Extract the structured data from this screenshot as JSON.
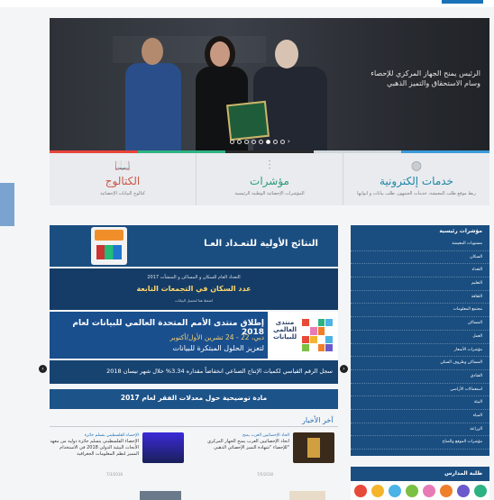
{
  "hero": {
    "caption": "الرئيس يمنح الجهاز المركزي للإحصاء وسام الاستحقاق والتميز الذهبي",
    "slides_total": 8,
    "slide_active": 5,
    "next_arrow": "›"
  },
  "strip_colors": [
    "#e8433a",
    "#2db383",
    "#2a2a2a",
    "#cfd6db",
    "#3a9ad9"
  ],
  "services": [
    {
      "title": "الكتالوج",
      "subtitle": "كتالوج البيانات الإحصائية",
      "icon": "book-icon",
      "glyph": "📖"
    },
    {
      "title": "مؤشرات",
      "subtitle": "المؤشرات الإحصائية الوطنية الرئيسية",
      "icon": "sliders-icon",
      "glyph": "⫶"
    },
    {
      "title": "خدمات إلكترونية",
      "subtitle": "ربط موقع طلب المعيشة، خدمات الجمهور، طلب بيانات و أبوابها",
      "icon": "globe-icon",
      "glyph": "◍"
    }
  ],
  "carousel": {
    "prev": "‹",
    "next": "›"
  },
  "banners": {
    "census": {
      "title": "النتائج الأولية للتعـداد العـا"
    },
    "population": {
      "line1": "التعداد العام للسكان و المساكن و المنشآت 2017",
      "line2": "عدد السكان في التجمعات التابعة",
      "line3": "اضغط هنا لتحميل البيانات"
    },
    "forum": {
      "line1": "إطلاق منتدى الأمم المتحدة العالمي للبيانات لعام 2018",
      "line2": "دبي، 22 - 24 تشرين الأول/أكتوبر",
      "line3": "لتعزيز الحلول المبتكرة للبيانات",
      "logo_text": "منتدى العالمي للبيانات"
    },
    "industrial": {
      "text": "سجل الرقم القياسي لكميات الإنتاج الصناعي انخفاضاً مقداره 3.34% خلال شهر نيسان 2018"
    },
    "poverty": {
      "text": "مادة توضيحية حول معدلات الفقر لعام 2017"
    }
  },
  "news": {
    "heading": "آخر الأخبار",
    "items": [
      {
        "category": "الحاد الإحصائيين العرب يمنح",
        "text": "اتحاد الإحصائيين العرب يمنح الجهاز المركزي للإحصاء \"شهادة التميز الإحصائي الذهبي\"",
        "date": "7/5/2018"
      },
      {
        "category": "الإحصاء الفلسطيني يتسلم جائزة",
        "text": "الإحصاء الفلسطيني يتسلم جائزة دولية من معهد الأبحاث البيئية الدولي 2018 في الاستخدام المميز لنظم المعلومات الجغرافية",
        "date": "7/3/2018"
      }
    ]
  },
  "key_indicators": {
    "heading": "مؤشرات رئيسية",
    "items": [
      "مستويات المعيشة",
      "السكان",
      "التعداد",
      "التعليم",
      "الثقافة",
      "مجتمع المعلومات",
      "المساكن",
      "العمل",
      "مؤشرات الأسعار",
      "المساكن وظروف السكن",
      "الفنادق",
      "استعمالات الأراضي",
      "البيئة",
      "المياه",
      "الزراعة",
      "مؤشرات الموقع والمناخ"
    ]
  },
  "schools": {
    "heading": "طلبة المدارس"
  },
  "kids_colors": [
    "#e84a3a",
    "#f4b52c",
    "#4bb3e6",
    "#7bc043",
    "#e87bb5",
    "#f07f2a",
    "#6a5acd",
    "#2db383"
  ]
}
